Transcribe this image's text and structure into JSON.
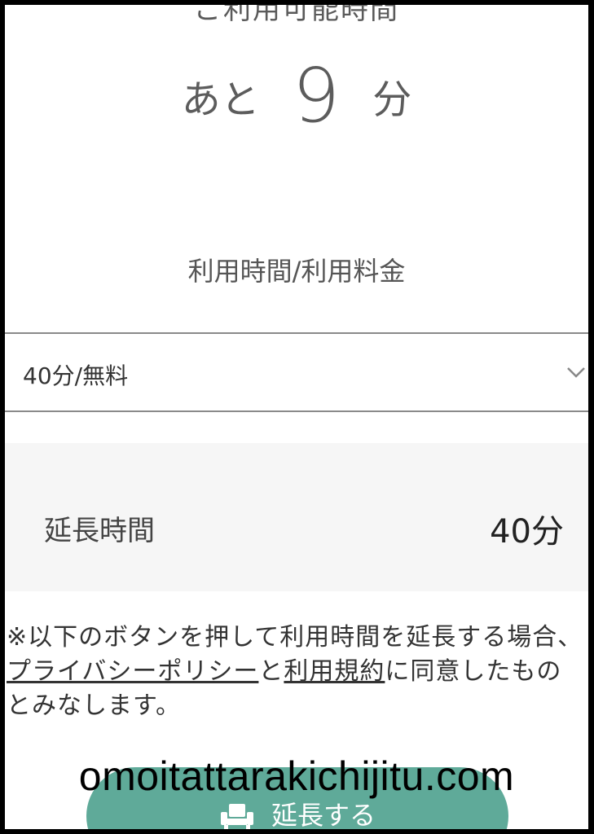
{
  "header": {
    "title_partial": "ご利用可能時間",
    "remaining_prefix": "あと",
    "remaining_value": "9",
    "remaining_unit": "分"
  },
  "plan": {
    "section_label": "利用時間/利用料金",
    "selected_option": "40分/無料"
  },
  "extension": {
    "label": "延長時間",
    "value": "40分"
  },
  "notice": {
    "part1": "※以下のボタンを押して利用時間を延長する場合、",
    "privacy_link": "プライバシーポリシー",
    "part2": "と",
    "terms_link": "利用規約",
    "part3": "に同意したものとみなします。"
  },
  "action": {
    "extend_label": "延長する",
    "icon": "armchair-icon",
    "color": "#5faa99"
  },
  "watermark": {
    "text": "omoitattarakichijitu.com"
  }
}
